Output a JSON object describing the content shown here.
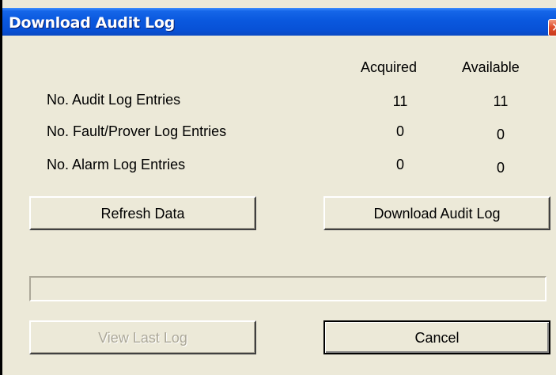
{
  "window": {
    "title": "Download Audit Log",
    "close_glyph": "✕"
  },
  "columns": {
    "acquired": "Acquired",
    "available": "Available"
  },
  "rows": [
    {
      "label": "No. Audit Log Entries",
      "acquired": "11",
      "available": "11"
    },
    {
      "label": "No. Fault/Prover Log Entries",
      "acquired": "0",
      "available": "0"
    },
    {
      "label": "No. Alarm Log Entries",
      "acquired": "0",
      "available": "0"
    }
  ],
  "buttons": {
    "refresh": "Refresh Data",
    "download": "Download Audit Log",
    "view_last": "View Last Log",
    "cancel": "Cancel"
  },
  "progress": {
    "fraction": 0
  }
}
